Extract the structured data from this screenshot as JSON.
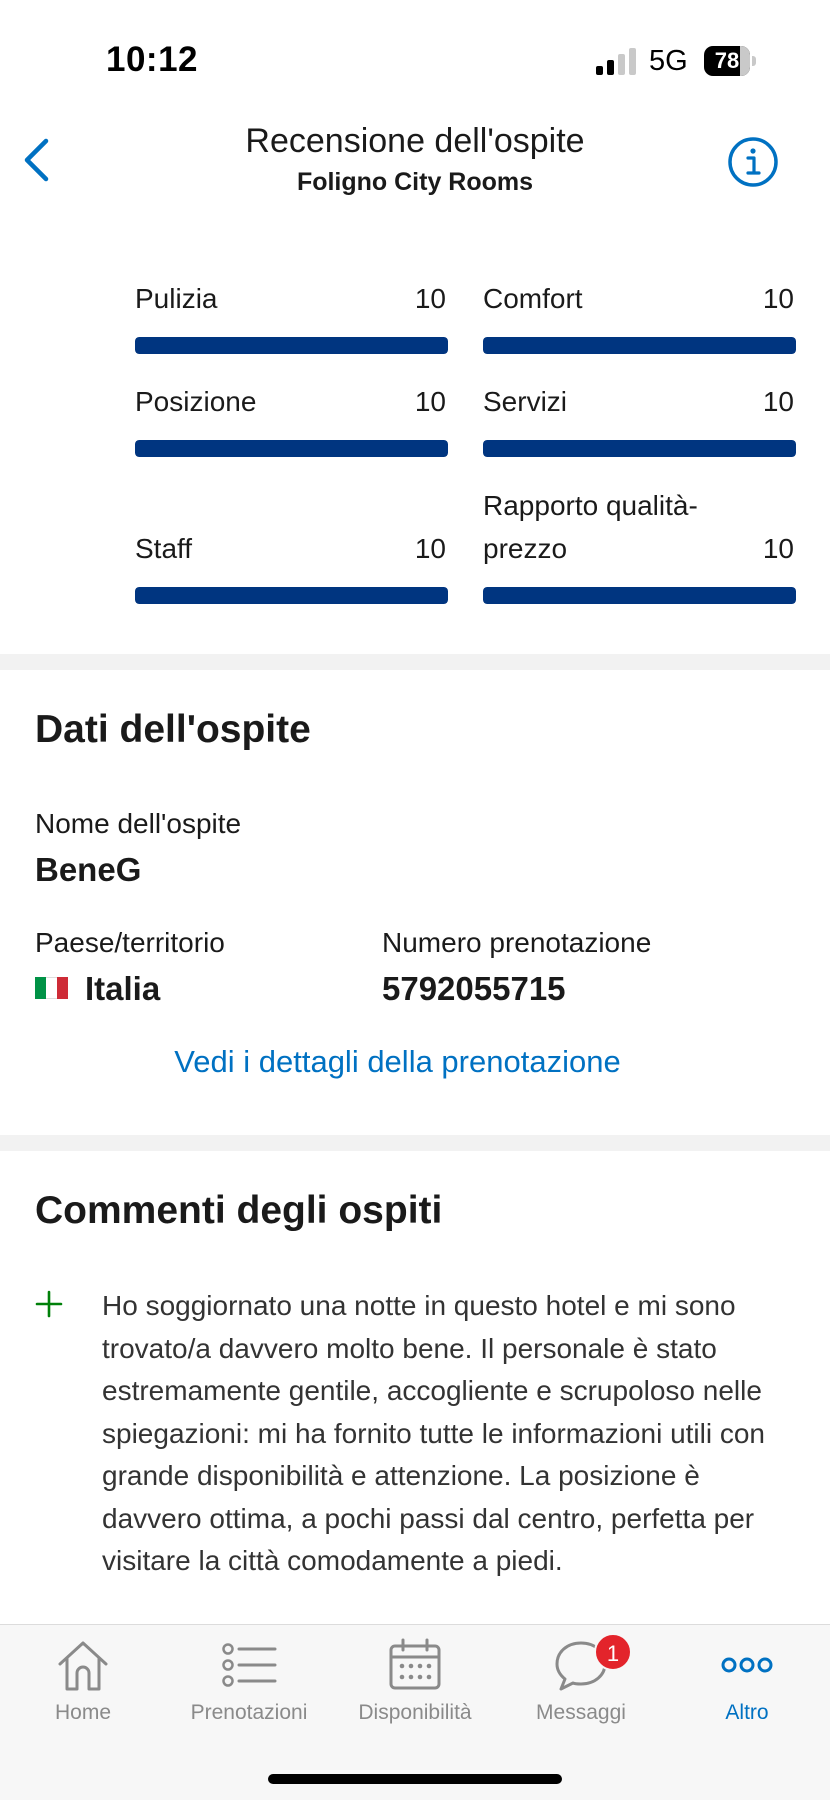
{
  "status_bar": {
    "time": "10:12",
    "network": "5G",
    "battery": "78",
    "battery_level_percent": 78,
    "signal_bars_active": 2,
    "signal_bars_total": 4
  },
  "header": {
    "title": "Recensione dell'ospite",
    "subtitle": "Foligno City Rooms",
    "back_icon": "chevron-left-icon",
    "info_icon": "info-icon",
    "accent_color": "#0071c2"
  },
  "scores": {
    "max_score": 10,
    "bar_color": "#003580",
    "items": [
      {
        "label": "Pulizia",
        "value": "10",
        "score": 10
      },
      {
        "label": "Comfort",
        "value": "10",
        "score": 10
      },
      {
        "label": "Posizione",
        "value": "10",
        "score": 10
      },
      {
        "label": "Servizi",
        "value": "10",
        "score": 10
      },
      {
        "label": "Staff",
        "value": "10",
        "score": 10
      },
      {
        "label": "Rapporto qualità-prezzo",
        "value": "10",
        "score": 10
      }
    ]
  },
  "guest_data": {
    "title": "Dati dell'ospite",
    "name_label": "Nome dell'ospite",
    "name": "BeneG",
    "country_label": "Paese/territorio",
    "country": "Italia",
    "country_flag_icon": "italy-flag-icon",
    "booking_label": "Numero prenotazione",
    "booking_number": "5792055715",
    "details_link": "Vedi i dettagli della prenotazione"
  },
  "comments": {
    "title": "Commenti degli ospiti",
    "positive_icon": "plus-icon",
    "positive_color": "#008009",
    "text": "Ho soggiornato una notte in questo hotel e mi sono trovato/a davvero molto bene. Il personale è stato estremamente gentile, accogliente e scrupoloso nelle spiegazioni: mi ha fornito tutte le informazioni utili con grande disponibilità e attenzione. La posizione è davvero ottima, a pochi passi dal centro, perfetta per visitare la città comodamente a piedi."
  },
  "tabbar": {
    "active_color": "#0071c2",
    "inactive_color": "#8a8a8a",
    "tabs": [
      {
        "label": "Home",
        "icon": "home-icon"
      },
      {
        "label": "Prenotazioni",
        "icon": "list-icon"
      },
      {
        "label": "Disponibilità",
        "icon": "calendar-icon"
      },
      {
        "label": "Messaggi",
        "icon": "chat-bubble-icon",
        "badge": "1"
      },
      {
        "label": "Altro",
        "icon": "more-dots-icon"
      }
    ]
  }
}
